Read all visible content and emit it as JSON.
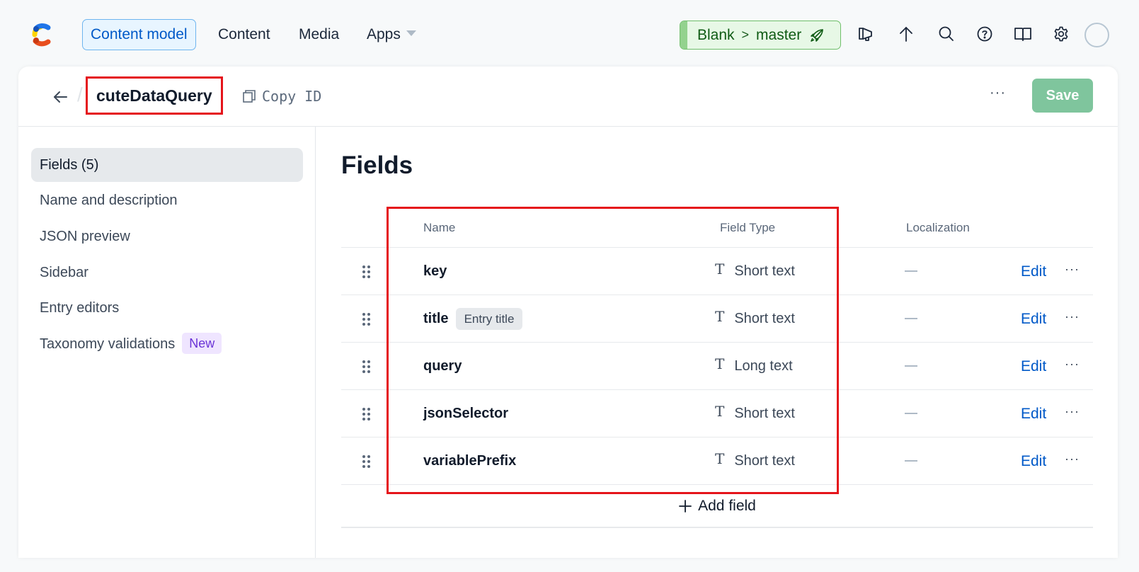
{
  "nav": {
    "items": [
      {
        "label": "Content model",
        "active": true
      },
      {
        "label": "Content",
        "active": false
      },
      {
        "label": "Media",
        "active": false
      },
      {
        "label": "Apps",
        "active": false,
        "has_dropdown": true
      }
    ],
    "environment": {
      "space": "Blank",
      "branch": "master",
      "icon": "rocket-icon"
    },
    "icons": [
      "megaphone-icon",
      "arrow-up-icon",
      "search-icon",
      "help-icon",
      "book-icon",
      "gear-icon"
    ],
    "colors": {
      "accent": "#0059c8",
      "env_bg": "#e7f8e6",
      "env_text": "#0f5b14"
    }
  },
  "header": {
    "back_label": "Back",
    "content_type_name": "cuteDataQuery",
    "copy_id_label": "Copy ID",
    "more_label": "···",
    "save_label": "Save"
  },
  "sidebar": {
    "items": [
      {
        "label": "Fields (5)",
        "active": true
      },
      {
        "label": "Name and description",
        "active": false
      },
      {
        "label": "JSON preview",
        "active": false
      },
      {
        "label": "Sidebar",
        "active": false
      },
      {
        "label": "Entry editors",
        "active": false
      },
      {
        "label": "Taxonomy validations",
        "active": false,
        "badge": "New"
      }
    ]
  },
  "main": {
    "title": "Fields",
    "columns": {
      "name": "Name",
      "field_type": "Field Type",
      "localization": "Localization"
    },
    "fields": [
      {
        "name": "key",
        "badge": null,
        "type": "Short text",
        "localization": "—",
        "action": "Edit"
      },
      {
        "name": "title",
        "badge": "Entry title",
        "type": "Short text",
        "localization": "—",
        "action": "Edit"
      },
      {
        "name": "query",
        "badge": null,
        "type": "Long text",
        "localization": "—",
        "action": "Edit"
      },
      {
        "name": "jsonSelector",
        "badge": null,
        "type": "Short text",
        "localization": "—",
        "action": "Edit"
      },
      {
        "name": "variablePrefix",
        "badge": null,
        "type": "Short text",
        "localization": "—",
        "action": "Edit"
      }
    ],
    "type_icon_glyph": "T",
    "row_more_label": "···",
    "add_field_label": "Add field"
  }
}
